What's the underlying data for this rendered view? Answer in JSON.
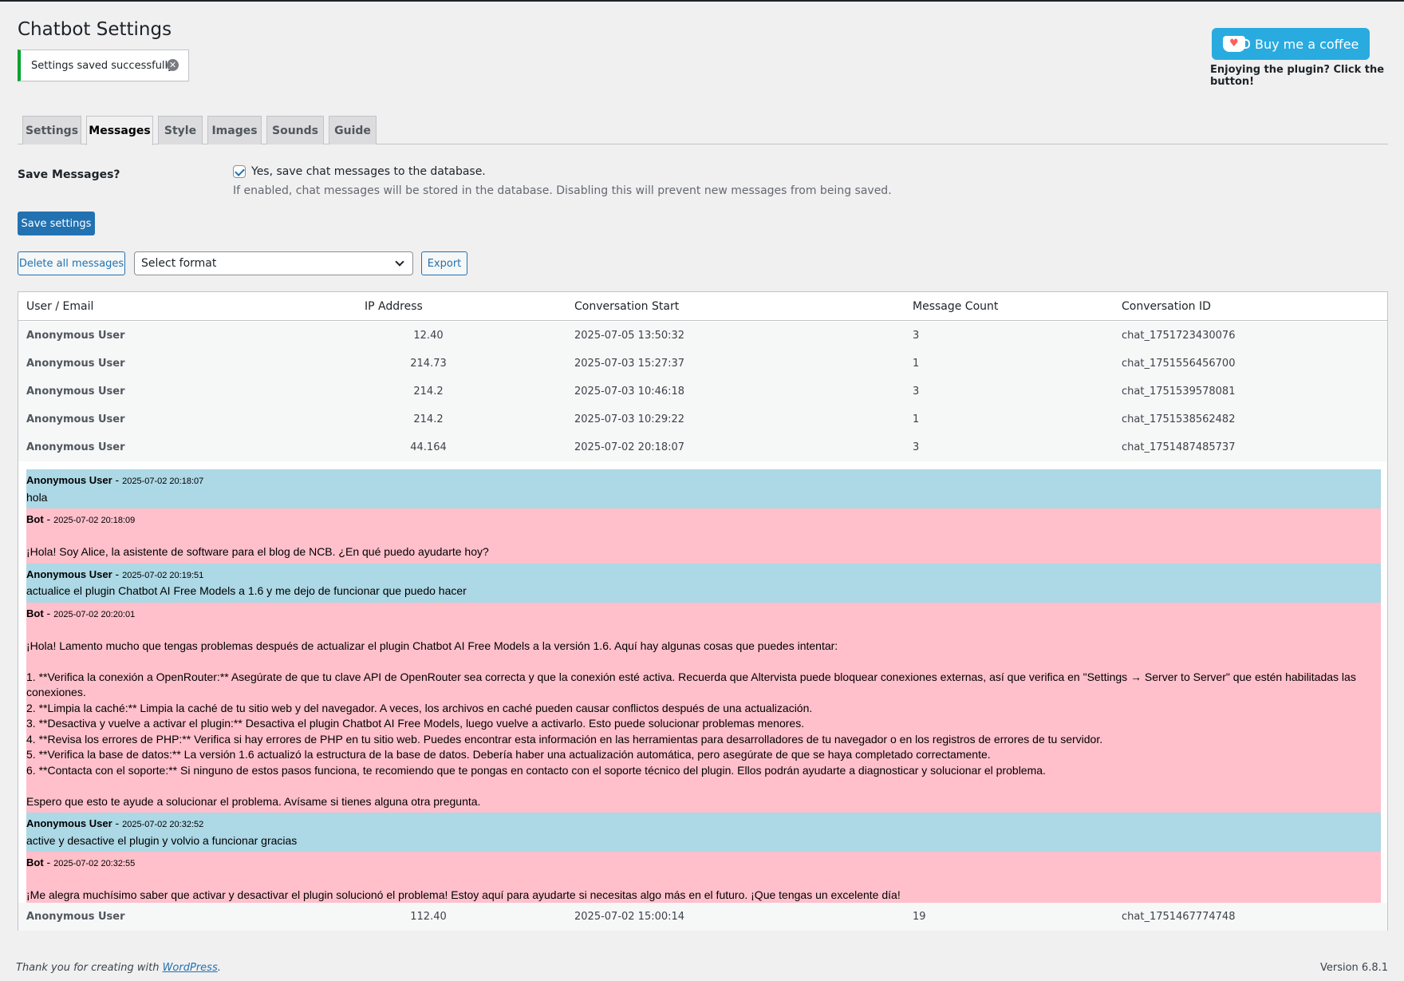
{
  "header": {
    "title": "Chatbot Settings",
    "notice": "Settings saved successfully.",
    "coffee_button": "Buy me a coffee",
    "coffee_note": "Enjoying the plugin? Click the button!"
  },
  "tabs": [
    {
      "label": "Settings",
      "active": false
    },
    {
      "label": "Messages",
      "active": true
    },
    {
      "label": "Style",
      "active": false
    },
    {
      "label": "Images",
      "active": false
    },
    {
      "label": "Sounds",
      "active": false
    },
    {
      "label": "Guide",
      "active": false
    }
  ],
  "form": {
    "label": "Save Messages?",
    "checkbox_label": "Yes, save chat messages to the database.",
    "checked": true,
    "description": "If enabled, chat messages will be stored in the database. Disabling this will prevent new messages from being saved.",
    "save_button": "Save settings"
  },
  "actions": {
    "delete_button": "Delete all messages",
    "select_value": "Select format",
    "export_button": "Export"
  },
  "table": {
    "headers": [
      "User / Email",
      "IP Address",
      "Conversation Start",
      "Message Count",
      "Conversation ID"
    ],
    "rows": [
      {
        "user": "Anonymous User",
        "ip": "12.40",
        "start": "2025-07-05 13:50:32",
        "count": "3",
        "id": "chat_1751723430076"
      },
      {
        "user": "Anonymous User",
        "ip": "214.73",
        "start": "2025-07-03 15:27:37",
        "count": "1",
        "id": "chat_1751556456700"
      },
      {
        "user": "Anonymous User",
        "ip": "214.2",
        "start": "2025-07-03 10:46:18",
        "count": "3",
        "id": "chat_1751539578081"
      },
      {
        "user": "Anonymous User",
        "ip": "214.2",
        "start": "2025-07-03 10:29:22",
        "count": "1",
        "id": "chat_1751538562482"
      },
      {
        "user": "Anonymous User",
        "ip": "44.164",
        "start": "2025-07-02 20:18:07",
        "count": "3",
        "id": "chat_1751487485737"
      }
    ],
    "last_row": {
      "user": "Anonymous User",
      "ip": "112.40",
      "start": "2025-07-02 15:00:14",
      "count": "19",
      "id": "chat_1751467774748"
    }
  },
  "conversation": [
    {
      "role": "user",
      "who": "Anonymous User",
      "ts": "2025-07-02 20:18:07",
      "body": "hola"
    },
    {
      "role": "bot",
      "who": "Bot",
      "ts": "2025-07-02 20:18:09",
      "body": "\n¡Hola! Soy Alice, la asistente de software para el blog de NCB. ¿En qué puedo ayudarte hoy?"
    },
    {
      "role": "user",
      "who": "Anonymous User",
      "ts": "2025-07-02 20:19:51",
      "body": "actualice el plugin Chatbot AI Free Models a 1.6 y me dejo de funcionar que puedo hacer"
    },
    {
      "role": "bot",
      "who": "Bot",
      "ts": "2025-07-02 20:20:01",
      "body": "\n¡Hola! Lamento mucho que tengas problemas después de actualizar el plugin Chatbot AI Free Models a la versión 1.6. Aquí hay algunas cosas que puedes intentar:\n\n1. **Verifica la conexión a OpenRouter:** Asegúrate de que tu clave API de OpenRouter sea correcta y que la conexión esté activa. Recuerda que Altervista puede bloquear conexiones externas, así que verifica en \"Settings → Server to Server\" que estén habilitadas las conexiones.\n2. **Limpia la caché:** Limpia la caché de tu sitio web y del navegador. A veces, los archivos en caché pueden causar conflictos después de una actualización.\n3. **Desactiva y vuelve a activar el plugin:** Desactiva el plugin Chatbot AI Free Models, luego vuelve a activarlo. Esto puede solucionar problemas menores.\n4. **Revisa los errores de PHP:** Verifica si hay errores de PHP en tu sitio web. Puedes encontrar esta información en las herramientas para desarrolladores de tu navegador o en los registros de errores de tu servidor.\n5. **Verifica la base de datos:** La versión 1.6 actualizó la estructura de la base de datos. Debería haber una actualización automática, pero asegúrate de que se haya completado correctamente.\n6. **Contacta con el soporte:** Si ninguno de estos pasos funciona, te recomiendo que te pongas en contacto con el soporte técnico del plugin. Ellos podrán ayudarte a diagnosticar y solucionar el problema.\n\nEspero que esto te ayude a solucionar el problema. Avísame si tienes alguna otra pregunta."
    },
    {
      "role": "user",
      "who": "Anonymous User",
      "ts": "2025-07-02 20:32:52",
      "body": "active y desactive el plugin y volvio a funcionar gracias"
    },
    {
      "role": "bot",
      "who": "Bot",
      "ts": "2025-07-02 20:32:55",
      "body": "\n¡Me alegra muchísimo saber que activar y desactivar el plugin solucionó el problema! Estoy aquí para ayudarte si necesitas algo más en el futuro. ¡Que tengas un excelente día!"
    }
  ],
  "footer": {
    "thanks_prefix": "Thank you for creating with ",
    "thanks_link": "WordPress",
    "thanks_suffix": ".",
    "version": "Version 6.8.1"
  },
  "colors": {
    "primary": "#2271b1",
    "user_msg": "#add8e6",
    "bot_msg": "#ffc0cb",
    "notice_success": "#00a32a",
    "coffee": "#29abe0"
  }
}
